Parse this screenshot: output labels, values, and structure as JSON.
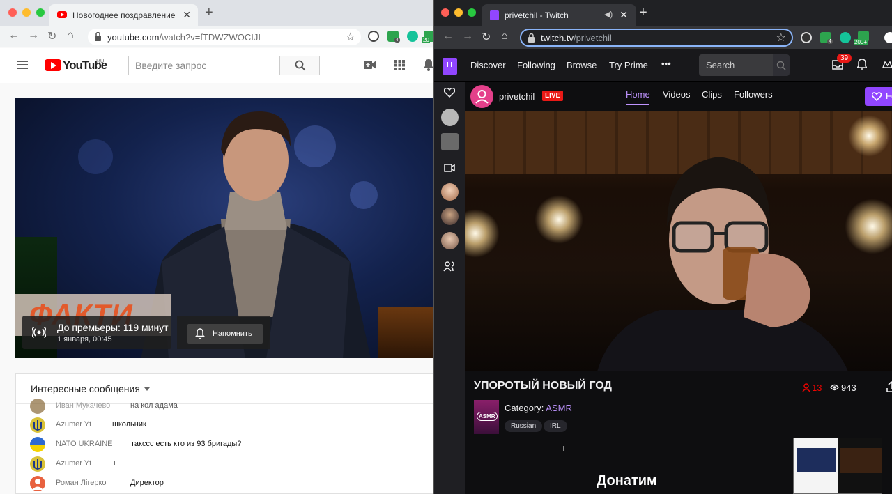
{
  "youtube_window": {
    "tab": {
      "title": "Новогоднее поздравление пре",
      "close": "✕"
    },
    "new_tab": "+",
    "url": {
      "host": "youtube.com",
      "path": "/watch?v=fTDWZWOCIJI"
    },
    "extensions": {
      "count_badge": "4",
      "badge_20": "20"
    },
    "header": {
      "logo": "YouTube",
      "region": "RU",
      "search_placeholder": "Введите запрос"
    },
    "player": {
      "overlay_brand": "ФАКТИ",
      "premiere_title": "До премьеры: 119 минут",
      "premiere_date": "1 января, 00:45",
      "remind_label": "Напомнить"
    },
    "chat": {
      "header": "Интересные сообщения",
      "messages": [
        {
          "author": "Иван Мукачево",
          "text": "на кол адама"
        },
        {
          "author": "Azumer Yt",
          "text": "школьник"
        },
        {
          "author": "NATO UKRAINE",
          "text": "таксcc есть кто из 93 бригады?"
        },
        {
          "author": "Azumer Yt",
          "text": "+"
        },
        {
          "author": "Роман Лігерко",
          "text": "Директор"
        }
      ]
    }
  },
  "twitch_window": {
    "tab": {
      "title": "privetchil - Twitch",
      "audio": "◀)",
      "close": "✕"
    },
    "new_tab": "+",
    "url": {
      "host": "twitch.tv",
      "path": "/privetchil"
    },
    "extensions": {
      "count_badge": "4",
      "badge_200": "200+"
    },
    "nav": {
      "links": [
        "Discover",
        "Following",
        "Browse",
        "Try Prime"
      ],
      "more": "•••",
      "search_placeholder": "Search",
      "notification_count": "39"
    },
    "channel": {
      "name": "privetchil",
      "live": "LIVE",
      "tabs": [
        "Home",
        "Videos",
        "Clips",
        "Followers"
      ],
      "follow_label": "Fo"
    },
    "stream": {
      "title": "УПОРОТЫЙ НОВЫЙ ГОД",
      "viewers": "13",
      "views": "943",
      "category_label": "Category:",
      "category": "ASMR",
      "category_box": "ASMR",
      "tags": [
        "Russian",
        "IRL"
      ],
      "overlay_text": "Донатим"
    }
  },
  "colors": {
    "youtube_red": "#ff0000",
    "twitch_purple": "#9146ff",
    "twitch_link": "#bf94ff",
    "live_red": "#e91916"
  }
}
